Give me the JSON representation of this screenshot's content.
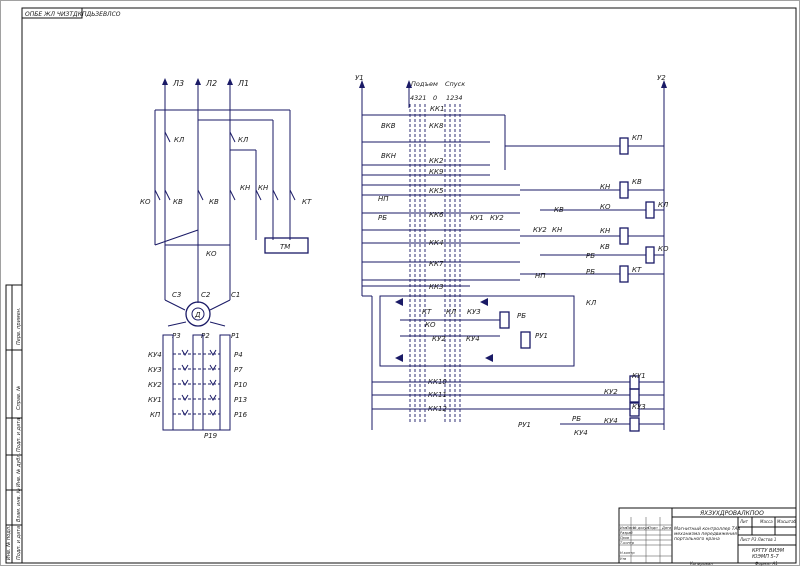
{
  "corner_stamp": "ОПБЕ ЖЛ ЧИЗТДКПДЬЗЕВЛСО",
  "power": {
    "phases": [
      "Л3",
      "Л2",
      "Л1"
    ],
    "contacts": [
      "КЛ",
      "КЛ",
      "КО",
      "КВ",
      "КВ",
      "КН",
      "КН",
      "КТ"
    ],
    "ko_label": "КО",
    "tm_label": "ТМ",
    "motor_terminals": [
      "С3",
      "С2",
      "С1"
    ],
    "motor_label": "Д",
    "rotor_terminals": [
      "Р3",
      "Р2",
      "Р1"
    ],
    "stage_labels": [
      "КУ4",
      "КУ3",
      "КУ2",
      "КУ1",
      "КП"
    ],
    "right_labels": [
      "Р4",
      "Р7",
      "Р10",
      "Р13",
      "Р16"
    ],
    "bottom_label": "Р19"
  },
  "control": {
    "bus_left": "У1",
    "bus_right": "У2",
    "hdr_up": "Подъем",
    "hdr_down": "Спуск",
    "positions_left": "4321",
    "positions_mid": "0",
    "positions_right": "1234",
    "kk": [
      "КК1",
      "КК8",
      "КК2",
      "КК9",
      "КК5",
      "КК6",
      "КК4",
      "КК7",
      "КК3",
      "КК10",
      "КК11",
      "КК12"
    ],
    "left_contacts": [
      "ВКВ",
      "ВКН",
      "НП",
      "РБ"
    ],
    "mid_contacts": [
      "КУ1",
      "КУ2",
      "КУ2",
      "КН",
      "НП",
      "РБ",
      "КЛ"
    ],
    "diode_block": [
      "КТ",
      "КЛ",
      "КУ3",
      "КО",
      "РБ",
      "КУ2",
      "КУ4",
      "РУ1"
    ],
    "coils": [
      "КП",
      "КВ",
      "КЛ",
      "КН",
      "КО",
      "КТ",
      "КУ1",
      "КУ2",
      "КУ3",
      "КУ4"
    ],
    "rel_contacts": [
      "КН",
      "КО",
      "КВ",
      "КН",
      "КВ",
      "РБ",
      "КУ4",
      "РУ1",
      "РБ"
    ]
  },
  "title_block": {
    "doc_code": "ЯХЗУХДРОВАЛКПОО",
    "title_lines": [
      "Магнитный контроллер ТА4",
      "механизма передвижения",
      "портального крана"
    ],
    "stage_hdr": [
      "Лит",
      "Масса",
      "Масштаб"
    ],
    "sheet_info": "Лист Р3 Листов 1",
    "org_lines": [
      "КРГТУ ВИЭМ",
      "ЮЭМП 5-7"
    ],
    "rev_hdr": [
      "Изм",
      "Лист",
      "№ докум",
      "Подп",
      "Дата"
    ],
    "rev_rows": [
      "Разраб",
      "Пров",
      "Т.контр",
      "Н.контр",
      "Утв"
    ],
    "copied": "Копировал",
    "format": "Формат А1"
  },
  "side_strip": [
    "Перв. примен.",
    "Справ. №",
    "Подп. и дата",
    "Инв. № дубл.",
    "Взам. инв. №",
    "Подп. и дата",
    "Инв. № подл."
  ]
}
